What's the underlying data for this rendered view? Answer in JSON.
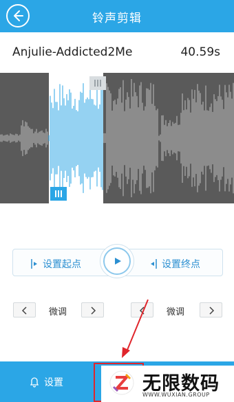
{
  "header": {
    "title": "铃声剪辑",
    "back_icon": "back-arrow-icon"
  },
  "song": {
    "name": "Anjulie-Addicted2Me",
    "duration": "40.59s"
  },
  "waveform": {
    "selection_start_fraction": 0.21,
    "selection_end_fraction": 0.44,
    "colors": {
      "selected": "#2ba6e6",
      "unselected": "#bdbdbd",
      "background_dark": "#5a5a5a",
      "selection_bg": "#ffffff"
    }
  },
  "controls": {
    "set_start_label": "设置起点",
    "set_end_label": "设置终点",
    "play_icon": "play-icon"
  },
  "fine_tune": {
    "left_label": "微调",
    "right_label": "微调"
  },
  "footer": {
    "settings_label": "设置",
    "settings_icon": "bell-icon"
  },
  "watermark": {
    "title": "无限数码",
    "subtitle": "WWW.WUXIAN.GROUP"
  },
  "colors": {
    "accent": "#2ba6e6",
    "highlight": "#e0252b"
  }
}
